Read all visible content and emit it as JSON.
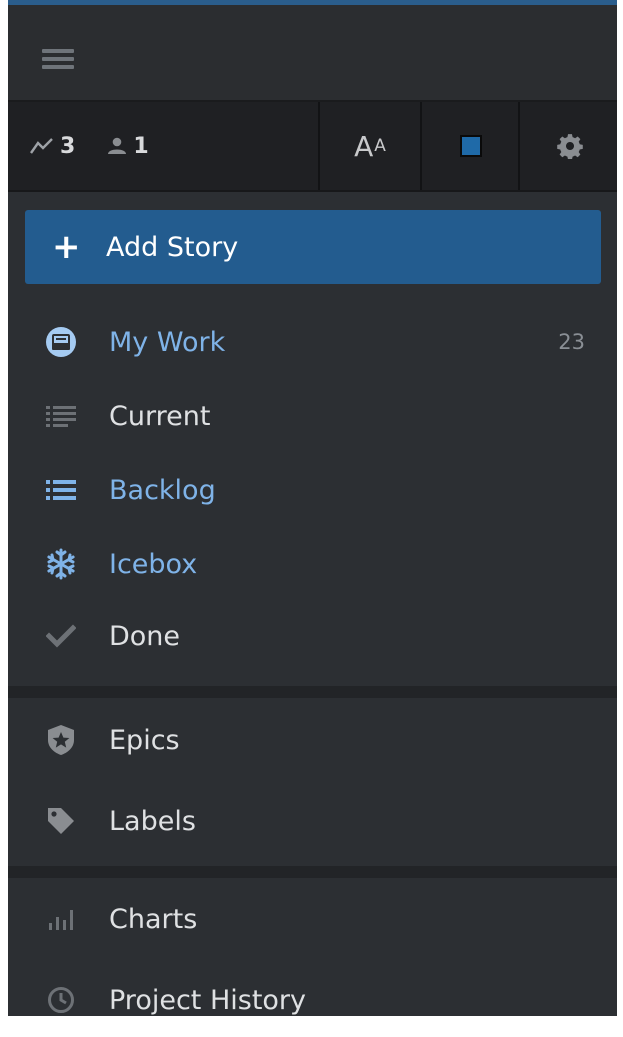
{
  "toolbar": {
    "velocity": "3",
    "members": "1",
    "font_big": "A",
    "font_small": "A",
    "swatch_color": "#1f6aa8"
  },
  "add_story": {
    "label": "Add Story"
  },
  "nav": {
    "my_work": {
      "label": "My Work",
      "count": "23"
    },
    "current": {
      "label": "Current"
    },
    "backlog": {
      "label": "Backlog"
    },
    "icebox": {
      "label": "Icebox"
    },
    "done": {
      "label": "Done"
    },
    "epics": {
      "label": "Epics"
    },
    "labels": {
      "label": "Labels"
    },
    "charts": {
      "label": "Charts"
    },
    "history": {
      "label": "Project History"
    }
  },
  "colors": {
    "panel_bg": "#2c2f33",
    "toolbar_bg": "#1f2023",
    "accent": "#235c8f",
    "active_text": "#7fb3e8",
    "icon_grey": "#8a8d91"
  }
}
